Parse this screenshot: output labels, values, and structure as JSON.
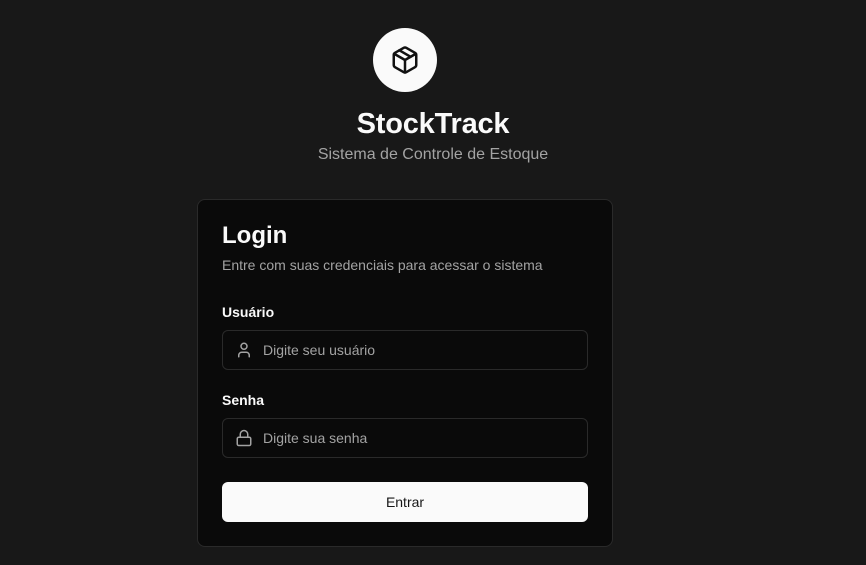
{
  "brand": {
    "logo_icon": "package-icon",
    "title": "StockTrack",
    "subtitle": "Sistema de Controle de Estoque"
  },
  "login_card": {
    "title": "Login",
    "description": "Entre com suas credenciais para acessar o sistema",
    "username": {
      "label": "Usuário",
      "placeholder": "Digite seu usuário",
      "value": "",
      "icon": "user-icon"
    },
    "password": {
      "label": "Senha",
      "placeholder": "Digite sua senha",
      "value": "",
      "icon": "lock-icon"
    },
    "submit_label": "Entrar"
  },
  "colors": {
    "background": "#181818",
    "card_background": "#0a0a0a",
    "border": "#2a2a2a",
    "primary_text": "#fafafa",
    "muted_text": "#a3a3a3",
    "button_background": "#fafafa",
    "button_text": "#171717"
  }
}
